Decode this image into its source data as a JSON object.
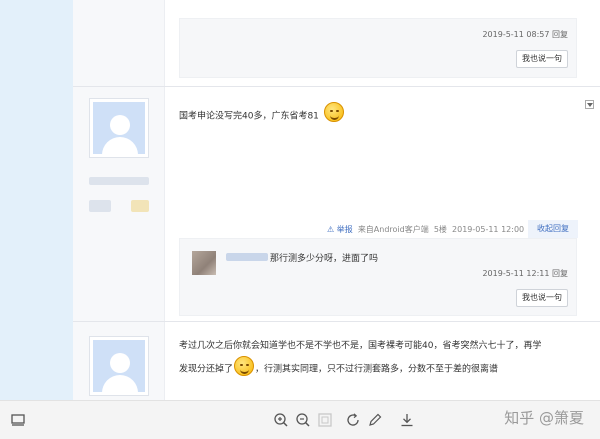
{
  "post0": {
    "date": "2019-5-11 08:57",
    "reply_label": "回复",
    "say_button": "我也说一句"
  },
  "post1": {
    "text": "国考申论没写完40多，广东省考81",
    "emoji": "smiley-emoji",
    "report_label": "举报",
    "source_label": "来自Android客户端",
    "floor": "5楼",
    "datetime": "2019-05-11 12:00",
    "collapse_label": "收起回复",
    "reply": {
      "text": "那行测多少分呀，进面了吗",
      "date": "2019-5-11 12:11",
      "reply_label": "回复"
    },
    "say_button": "我也说一句"
  },
  "post2": {
    "text_line1": "考过几次之后你就会知道学也不是不学也不是，国考裸考可能40，省考突然六七十了，再学",
    "text_line2_before": "发现分还掉了",
    "text_line2_after": "，行测其实同理，只不过行测套路多，分数不至于差的很离谱",
    "emoji": "thinking-emoji"
  },
  "toolbar": {
    "icons": [
      "monitor-icon",
      "zoom-in-icon",
      "zoom-out-icon",
      "fit-icon",
      "rotate-icon",
      "edit-icon",
      "download-icon"
    ],
    "watermark": "知乎 @箫夏"
  }
}
